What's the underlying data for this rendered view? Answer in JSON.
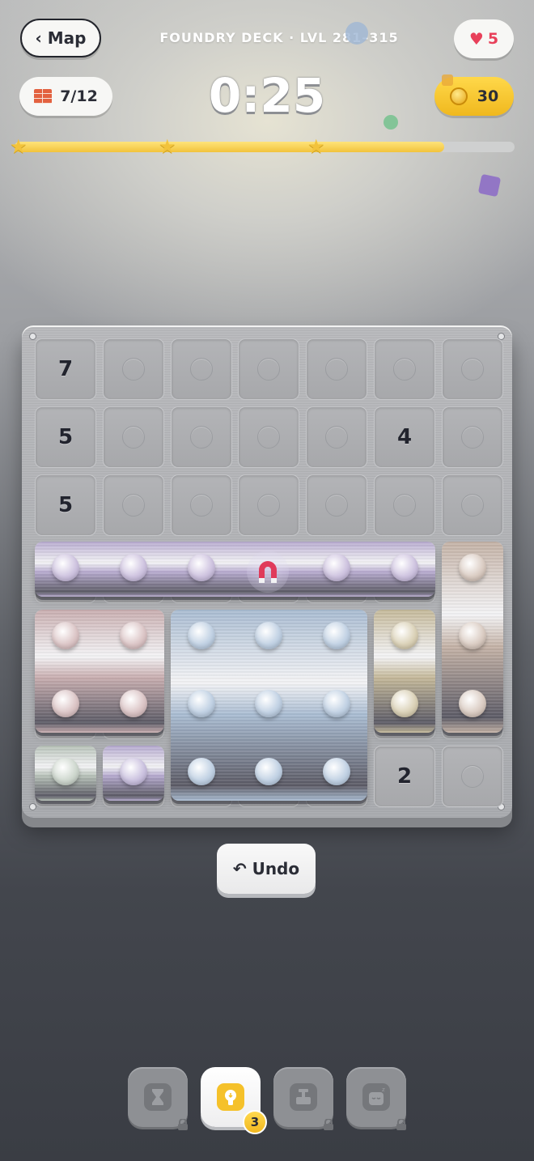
{
  "header": {
    "back_label": "‹ Map",
    "level_title": "FOUNDRY DECK · LVL 281–315",
    "lives": "5",
    "bricks": "7/12",
    "timer": "0:25",
    "coins": "30"
  },
  "progress": {
    "fraction": 0.86,
    "stars": 3
  },
  "board": {
    "columns": 7,
    "rows": 7,
    "clues": [
      {
        "row": 0,
        "col": 0,
        "value": "7"
      },
      {
        "row": 1,
        "col": 0,
        "value": "5"
      },
      {
        "row": 1,
        "col": 5,
        "value": "4"
      },
      {
        "row": 2,
        "col": 0,
        "value": "5"
      },
      {
        "row": 6,
        "col": 5,
        "value": "2"
      }
    ],
    "pieces": [
      {
        "name": "piece-purple-bar",
        "color": "#b8abd0",
        "stud": "#cfc4e0",
        "cells": [
          [
            3,
            0
          ],
          [
            3,
            1
          ],
          [
            3,
            2
          ],
          [
            3,
            3
          ],
          [
            3,
            4
          ],
          [
            3,
            5
          ]
        ]
      },
      {
        "name": "piece-rose-block",
        "color": "#c9aeb0",
        "stud": "#dcc6c7",
        "cells": [
          [
            4,
            0
          ],
          [
            4,
            1
          ],
          [
            5,
            0
          ],
          [
            5,
            1
          ]
        ]
      },
      {
        "name": "piece-blue-block",
        "color": "#a9bcd2",
        "stud": "#c2d2e4",
        "cells": [
          [
            4,
            2
          ],
          [
            4,
            3
          ],
          [
            4,
            4
          ],
          [
            5,
            2
          ],
          [
            5,
            3
          ],
          [
            5,
            4
          ],
          [
            6,
            2
          ],
          [
            6,
            3
          ],
          [
            6,
            4
          ]
        ]
      },
      {
        "name": "piece-khaki-bar",
        "color": "#c5b99a",
        "stud": "#dbd2b8",
        "cells": [
          [
            4,
            5
          ],
          [
            5,
            5
          ]
        ]
      },
      {
        "name": "piece-taupe-bar",
        "color": "#c4b2a6",
        "stud": "#dbcdc4",
        "cells": [
          [
            3,
            6
          ],
          [
            4,
            6
          ],
          [
            5,
            6
          ]
        ]
      },
      {
        "name": "piece-green-single",
        "color": "#b7c2b8",
        "stud": "#cfd8cf",
        "cells": [
          [
            6,
            0
          ]
        ]
      },
      {
        "name": "piece-violet-single",
        "color": "#b5a9cf",
        "stud": "#ccc3e0",
        "cells": [
          [
            6,
            1
          ]
        ]
      }
    ],
    "magnet_cell": [
      3,
      3
    ]
  },
  "actions": {
    "undo_label": "↶ Undo"
  },
  "tools": [
    {
      "name": "hourglass",
      "locked": true
    },
    {
      "name": "hint",
      "locked": false,
      "count": "3"
    },
    {
      "name": "hammer",
      "locked": true
    },
    {
      "name": "freeze",
      "locked": true
    }
  ],
  "colors": {
    "accent_yellow": "#f2c33c",
    "heart_red": "#e8405a",
    "magnet_red": "#e03a5a"
  }
}
